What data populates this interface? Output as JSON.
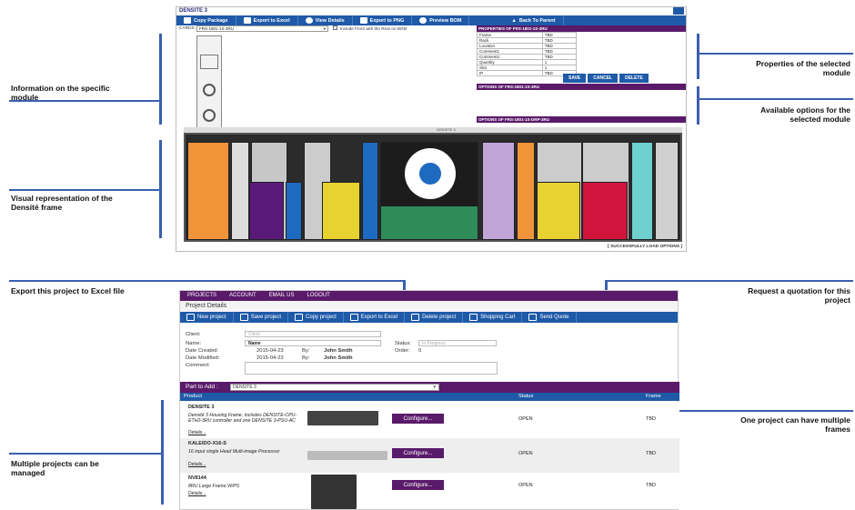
{
  "callouts": {
    "info_module": "Information on the specific module",
    "props_selected": "Properties of the selected module",
    "options_selected": "Available options for the selected module",
    "visual_rep": "Visual representation of the Densité frame",
    "export_excel": "Export this project to Excel file",
    "request_quote": "Request a quotation for this project",
    "one_project": "One project can have multiple frames",
    "multiple_projects": "Multiple projects can be managed"
  },
  "top": {
    "title": "DENSITE 3",
    "toolbar": [
      "Copy Package",
      "Export to Excel",
      "View Details",
      "Export to PNG",
      "Preview BOM",
      "Back To Parent"
    ],
    "cards_label": "CARDS :",
    "cards_value": "FRS-1801-1S-3RU",
    "include_front": "Include Front with the Rear on BOM",
    "properties_title": "PROPERTIES OF FRS-1801-1S-3RU",
    "properties": [
      {
        "k": "Frame",
        "v": "TBD"
      },
      {
        "k": "Rack",
        "v": "TBD"
      },
      {
        "k": "Location",
        "v": "TBD"
      },
      {
        "k": "Comment1",
        "v": "TBD"
      },
      {
        "k": "Comment2",
        "v": "TBD"
      },
      {
        "k": "Quantity",
        "v": "1"
      },
      {
        "k": "Slot",
        "v": "1"
      },
      {
        "k": "IP",
        "v": "TBD"
      }
    ],
    "buttons": [
      "SAVE",
      "CANCEL",
      "DELETE"
    ],
    "options_title": "OPTIONS OF FRS-1801-1S-3RU",
    "options_title2": "OPTIONS OF FRS-1801-1S-DRP-3RU",
    "frame_label": "DENSITE 3",
    "status": "[ SUCCESSFULLY LOAD OPTIONS ]"
  },
  "bottom": {
    "nav": [
      "PROJECTS",
      "ACCOUNT",
      "EMAIL US",
      "LOGOUT"
    ],
    "page_title": "Project Details",
    "toolbar": [
      "New project",
      "Save project",
      "Copy project",
      "Export to Excel",
      "Delete project",
      "Shopping Cart",
      "Send Quote"
    ],
    "form": {
      "client_label": "Client:",
      "client_placeholder": "Client",
      "name_label": "Name:",
      "name_value": "Name",
      "status_label": "Status:",
      "status_value": "In Progress",
      "created_label": "Date Created:",
      "created_value": "2015-04-23",
      "created_by_label": "By:",
      "created_by": "John Smith",
      "order_label": "Order:",
      "order_value": "0",
      "modified_label": "Date Modified:",
      "modified_value": "2015-04-23",
      "modified_by_label": "By:",
      "modified_by": "John Smith",
      "comment_label": "Comment:"
    },
    "part_to_add_label": "Part to Add :",
    "part_to_add_value": "DENSITE 3",
    "columns": [
      "Product",
      "Status",
      "Frame"
    ],
    "rows": [
      {
        "name": "DENSITE 3",
        "desc": "Densité 3 Housing Frame, includes DENSITE-CPU-ETH2-3RU controller and one DENSITE 3-PSU-AC",
        "details": "Details...",
        "configure": "Configure...",
        "status": "OPEN",
        "frame": "TBD"
      },
      {
        "name": "KALEIDO-X16-S",
        "desc": "16 input single Head Multi-image Processor",
        "details": "Details...",
        "configure": "Configure...",
        "status": "OPEN",
        "frame": "TBD"
      },
      {
        "name": "NV8144",
        "desc": "8RU Large Frame W/PS",
        "details": "Details...",
        "configure": "Configure...",
        "status": "OPEN",
        "frame": "TBD"
      }
    ]
  },
  "colors": {
    "accent_blue": "#1e5aa8",
    "purple": "#5a1a6a",
    "callout_line": "#3a5fae"
  }
}
